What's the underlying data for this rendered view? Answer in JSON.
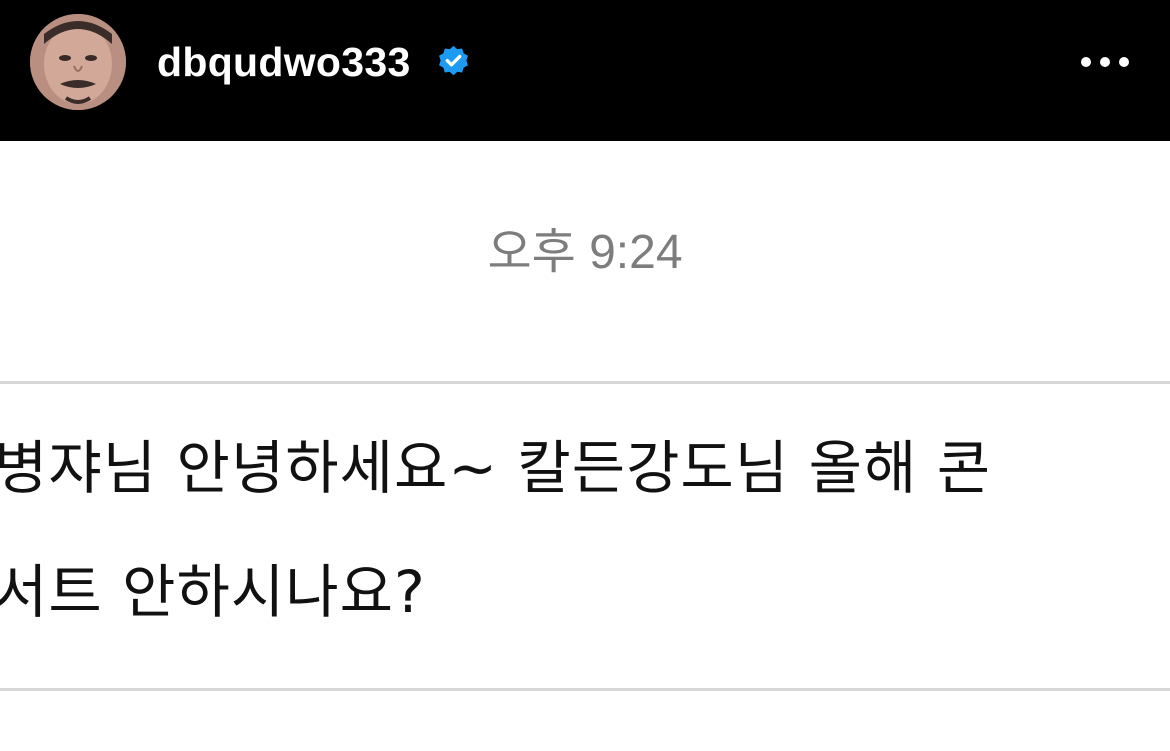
{
  "header": {
    "username": "dbqudwo333",
    "verified_color": "#1d9bf0",
    "more_icon": "more-horizontal-icon",
    "avatar": "profile-avatar"
  },
  "chat": {
    "timestamp": "오후 9:24",
    "message_lines": [
      "병쟈님 안녕하세요~ 칼든강도님 올해 콘",
      "서트 안하시나요?"
    ]
  }
}
